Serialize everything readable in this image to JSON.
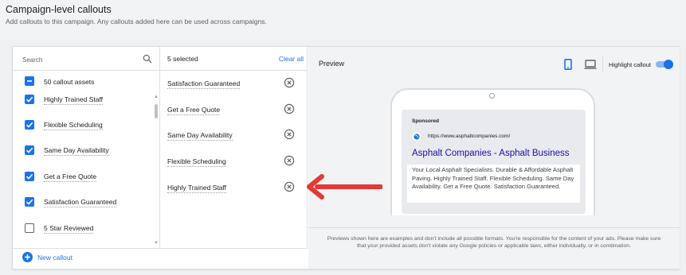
{
  "header": {
    "title": "Campaign-level callouts",
    "subtitle": "Add callouts to this campaign. Any callouts added here can be used across campaigns."
  },
  "picker": {
    "search_placeholder": "Search",
    "all_label": "50 callout assets",
    "all_state": "indeterminate",
    "assets": [
      {
        "label": "Highly Trained Staff",
        "checked": true
      },
      {
        "label": "Flexible Scheduling",
        "checked": true
      },
      {
        "label": "Same Day Availability",
        "checked": true
      },
      {
        "label": "Get a Free Quote",
        "checked": true
      },
      {
        "label": "Satisfaction Guaranteed",
        "checked": true
      },
      {
        "label": "5 Star Reviewed",
        "checked": false
      }
    ],
    "new_callout_label": "New callout"
  },
  "selected": {
    "count_label": "5 selected",
    "clear_all_label": "Clear all",
    "items": [
      "Satisfaction Guaranteed",
      "Get a Free Quote",
      "Same Day Availability",
      "Flexible Scheduling",
      "Highly Trained Staff"
    ]
  },
  "preview": {
    "title": "Preview",
    "highlight_label": "Highlight callout",
    "highlight_on": true,
    "device": "mobile",
    "ad": {
      "sponsored": "Sponsored",
      "url": "https://www.asphaltcompanies.com/",
      "headline": "Asphalt Companies - Asphalt Business",
      "body": "Your Local Asphalt Specialists. Durable & Affordable Asphalt Paving. Highly Trained Staff. Flexible Scheduling. Same Day Availability. Get a Free Quote. Satisfaction Guaranteed."
    },
    "disclaimer": "Previews shown here are examples and don't include all possible formats. You're responsible for the content of your ads. Please make sure that your provided assets don't violate any Google policies or applicable laws, either individually, or in combination."
  },
  "colors": {
    "accent": "#1a73e8",
    "annotation_arrow": "#e53935"
  },
  "icons": [
    "search-icon",
    "checkbox-icon",
    "remove-icon",
    "plus-icon",
    "mobile-icon",
    "desktop-icon",
    "globe-icon"
  ]
}
